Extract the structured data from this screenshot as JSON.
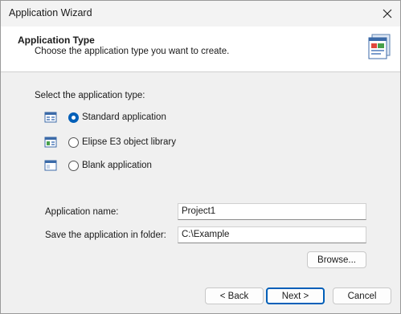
{
  "window": {
    "title": "Application Wizard",
    "close_glyph": "✕"
  },
  "header": {
    "title": "Application Type",
    "subtitle": "Choose the application type you want to create.",
    "icon": "wizard-application-icon"
  },
  "types": {
    "prompt": "Select the application type:",
    "options": [
      {
        "label": "Standard application",
        "selected": true,
        "icon": "standard-app-icon"
      },
      {
        "label": "Elipse E3 object library",
        "selected": false,
        "icon": "object-library-icon"
      },
      {
        "label": "Blank application",
        "selected": false,
        "icon": "blank-app-icon"
      }
    ]
  },
  "form": {
    "name_label": "Application name:",
    "name_value": "Project1",
    "folder_label": "Save the application in folder:",
    "folder_value": "C:\\Example",
    "browse_label": "Browse..."
  },
  "footer": {
    "back_label": "< Back",
    "next_label": "Next >",
    "cancel_label": "Cancel"
  },
  "colors": {
    "accent": "#005fb8",
    "header_bg": "#ffffff",
    "dialog_bg": "#f0f0f0"
  }
}
